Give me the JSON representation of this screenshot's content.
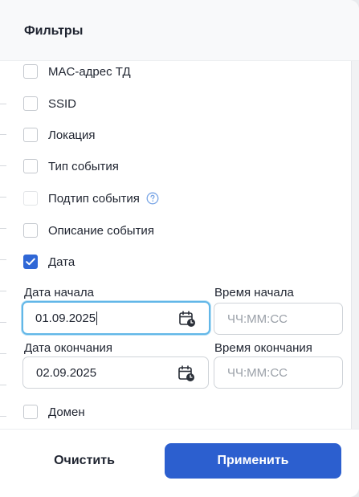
{
  "header": {
    "title": "Фильтры"
  },
  "filters": [
    {
      "label": "MAC-адрес ТД",
      "checked": false,
      "disabled": false
    },
    {
      "label": "SSID",
      "checked": false,
      "disabled": false
    },
    {
      "label": "Локация",
      "checked": false,
      "disabled": false
    },
    {
      "label": "Тип события",
      "checked": false,
      "disabled": false
    },
    {
      "label": "Подтип события",
      "checked": false,
      "disabled": true
    },
    {
      "label": "Описание события",
      "checked": false,
      "disabled": false
    },
    {
      "label": "Дата",
      "checked": true,
      "disabled": false
    },
    {
      "label": "Домен",
      "checked": false,
      "disabled": false
    }
  ],
  "date": {
    "start_label": "Дата начала",
    "start_value": "01.09.2025",
    "start_time_label": "Время начала",
    "start_time_placeholder": "ЧЧ:ММ:СС",
    "end_label": "Дата окончания",
    "end_value": "02.09.2025",
    "end_time_label": "Время окончания",
    "end_time_placeholder": "ЧЧ:ММ:СС"
  },
  "footer": {
    "clear_label": "Очистить",
    "apply_label": "Применить"
  },
  "colors": {
    "accent": "#2c5fcf",
    "focus": "#62b7e8",
    "help": "#7aa6e6"
  }
}
